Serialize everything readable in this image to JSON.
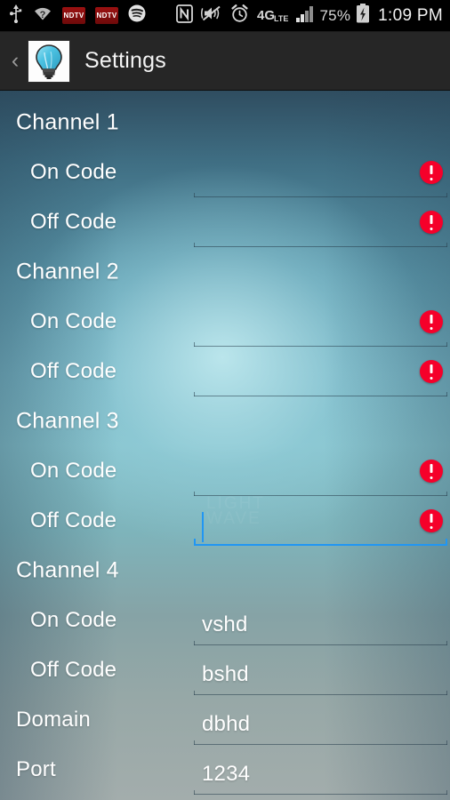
{
  "status_bar": {
    "icons": [
      {
        "name": "usb-icon",
        "label": "USB"
      },
      {
        "name": "wifi-question-icon",
        "label": "WiFi no internet"
      },
      {
        "name": "ndtv-icon-1",
        "label": "NDTV"
      },
      {
        "name": "ndtv-icon-2",
        "label": "NDTV"
      },
      {
        "name": "spotify-icon",
        "label": "Spotify"
      },
      {
        "name": "nfc-icon",
        "label": "NFC"
      },
      {
        "name": "mute-vibrate-icon",
        "label": "Sound off"
      },
      {
        "name": "alarm-clock-icon",
        "label": "Alarm"
      },
      {
        "name": "lte-4g-icon",
        "label": "4G LTE"
      },
      {
        "name": "signal-bars-icon",
        "label": "Signal"
      }
    ],
    "ndtv_label": "NDTV",
    "network_label_top": "4G",
    "network_label_bottom": "LTE",
    "battery_percent": "75%",
    "clock": "1:09 PM"
  },
  "action_bar": {
    "back_label": "‹",
    "app_icon_name": "lightbulb-icon",
    "title": "Settings"
  },
  "colors": {
    "accent_focus": "#2196f3",
    "error": "#f5002a",
    "action_bar_bg": "#262626",
    "status_bar_bg": "#000000",
    "bulb_glass": "#4ec3e0",
    "bulb_base": "#3a3a3a"
  },
  "form": {
    "rows": [
      {
        "type": "section",
        "label": "Channel 1"
      },
      {
        "type": "field",
        "label": "On Code",
        "value": "",
        "error": true,
        "focused": false
      },
      {
        "type": "field",
        "label": "Off Code",
        "value": "",
        "error": true,
        "focused": false
      },
      {
        "type": "section",
        "label": "Channel 2"
      },
      {
        "type": "field",
        "label": "On Code",
        "value": "",
        "error": true,
        "focused": false
      },
      {
        "type": "field",
        "label": "Off Code",
        "value": "",
        "error": true,
        "focused": false
      },
      {
        "type": "section",
        "label": "Channel 3"
      },
      {
        "type": "field",
        "label": "On Code",
        "value": "",
        "error": true,
        "focused": false
      },
      {
        "type": "field",
        "label": "Off Code",
        "value": "",
        "error": true,
        "focused": true
      },
      {
        "type": "section",
        "label": "Channel 4"
      },
      {
        "type": "field",
        "label": "On Code",
        "value": "vshd",
        "error": false,
        "focused": false
      },
      {
        "type": "field",
        "label": "Off Code",
        "value": "bshd",
        "error": false,
        "focused": false
      },
      {
        "type": "field",
        "label": "Domain",
        "value": "dbhd",
        "error": false,
        "focused": false,
        "label_left": 18
      },
      {
        "type": "field",
        "label": "Port",
        "value": "1234",
        "error": false,
        "focused": false,
        "label_left": 18
      }
    ]
  },
  "artifact": {
    "ghost_text": "LIGHT\nWAVE"
  }
}
